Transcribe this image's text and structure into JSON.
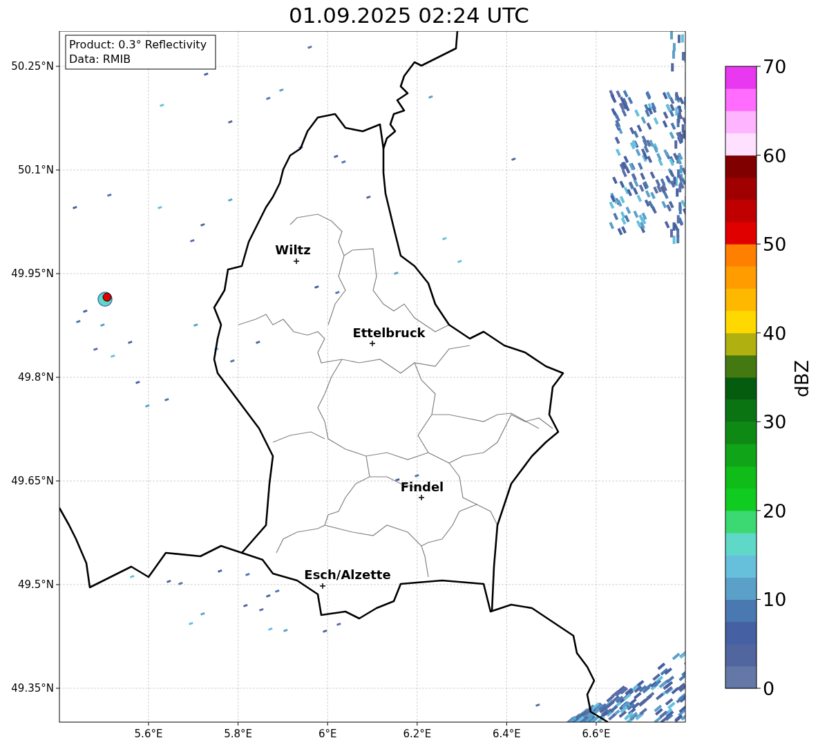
{
  "title": "01.09.2025 02:24 UTC",
  "info_box": {
    "lines": [
      "Product: 0.3° Reflectivity",
      "Data: RMIB"
    ]
  },
  "map": {
    "cities": [
      {
        "name": "Wiltz"
      },
      {
        "name": "Ettelbruck"
      },
      {
        "name": "Findel"
      },
      {
        "name": "Esch/Alzette"
      }
    ],
    "x_ticks": [
      "5.6°E",
      "5.8°E",
      "6°E",
      "6.2°E",
      "6.4°E",
      "6.6°E"
    ],
    "y_ticks": [
      "50.25°N",
      "50.1°N",
      "49.95°N",
      "49.8°N",
      "49.65°N",
      "49.5°N",
      "49.35°N"
    ]
  },
  "colorbar": {
    "label": "dBZ",
    "ticks": [
      "70",
      "60",
      "50",
      "40",
      "30",
      "20",
      "10",
      "0"
    ],
    "bands": [
      {
        "color": "#6478a8"
      },
      {
        "color": "#51659e"
      },
      {
        "color": "#4560a3"
      },
      {
        "color": "#4a78b0"
      },
      {
        "color": "#5aa0c8"
      },
      {
        "color": "#66c0dc"
      },
      {
        "color": "#60d8c8"
      },
      {
        "color": "#3cd872"
      },
      {
        "color": "#10cc20"
      },
      {
        "color": "#10bc18"
      },
      {
        "color": "#10a418"
      },
      {
        "color": "#0e8a14"
      },
      {
        "color": "#0a7412"
      },
      {
        "color": "#065c0e"
      },
      {
        "color": "#447810"
      },
      {
        "color": "#b0b010"
      },
      {
        "color": "#ffd800"
      },
      {
        "color": "#ffb800"
      },
      {
        "color": "#ff9c00"
      },
      {
        "color": "#ff8000"
      },
      {
        "color": "#e00000"
      },
      {
        "color": "#c00000"
      },
      {
        "color": "#a00000"
      },
      {
        "color": "#800000"
      },
      {
        "color": "#ffe0ff"
      },
      {
        "color": "#ffb4ff"
      },
      {
        "color": "#ff6cff"
      },
      {
        "color": "#e838f0"
      }
    ]
  }
}
